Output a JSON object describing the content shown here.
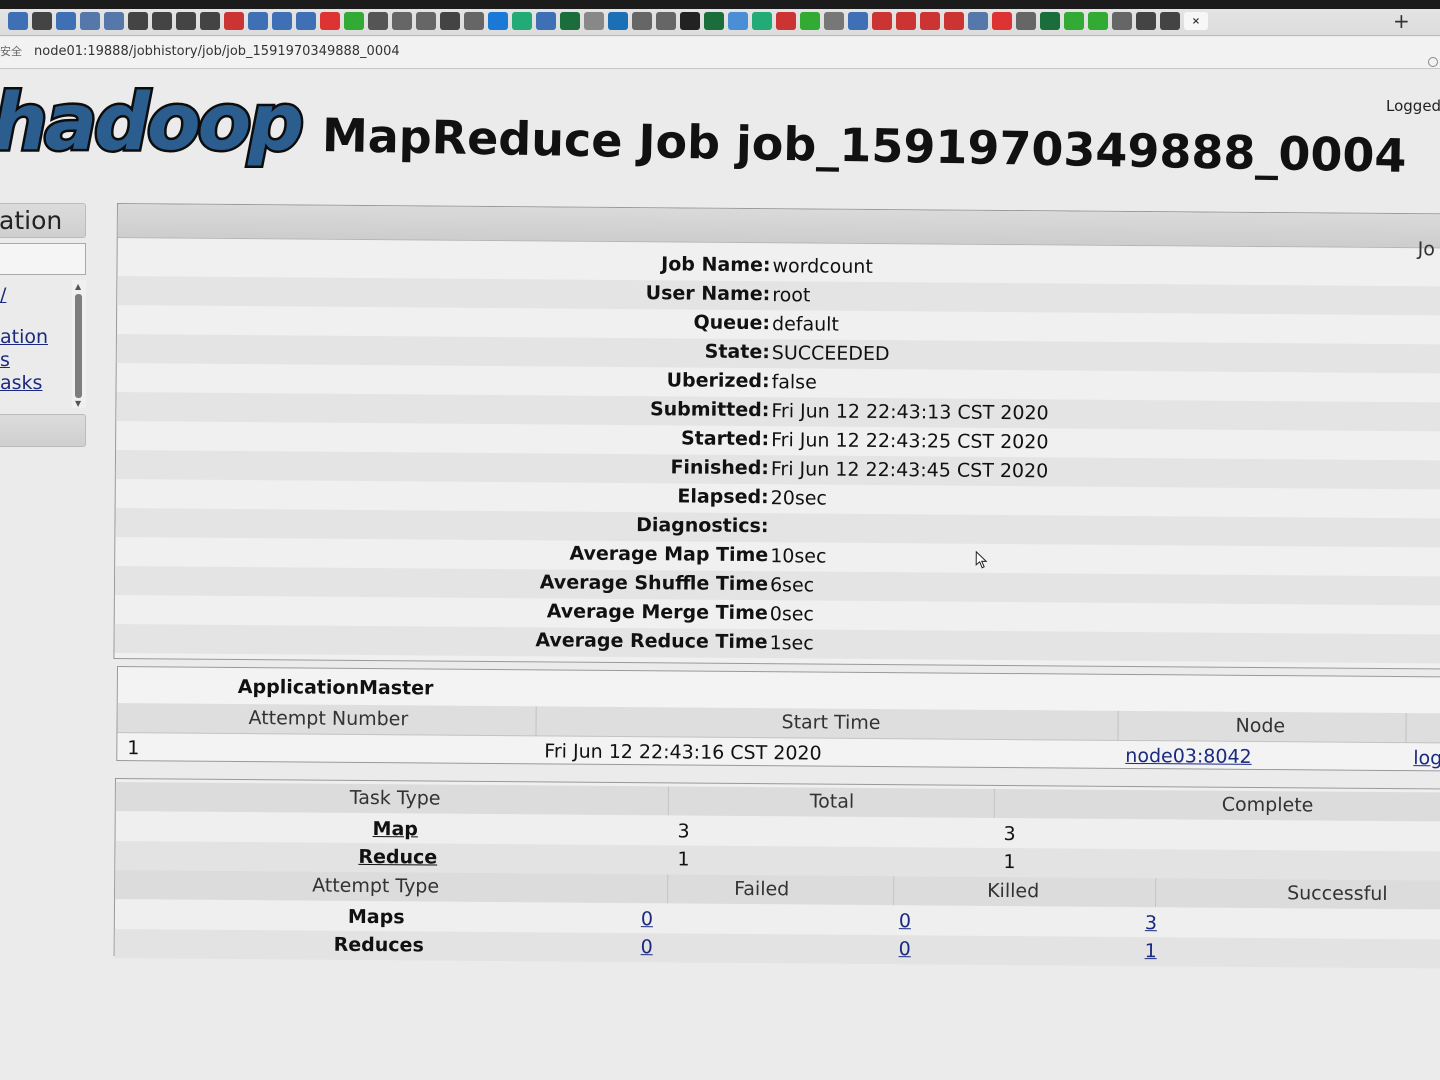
{
  "browser": {
    "secure_label": "安全",
    "url": "node01:19888/jobhistory/job/job_1591970349888_0004",
    "close_tab_glyph": "×",
    "new_tab_glyph": "+"
  },
  "header": {
    "logo_text": "hadoop",
    "title": "MapReduce Job job_1591970349888_0004",
    "logged_in": "Logged"
  },
  "sidebar": {
    "section_label": "ation",
    "links": [
      "/",
      "ation",
      "s",
      "asks"
    ]
  },
  "job_overview": {
    "panel_label": "Jo",
    "rows": [
      {
        "key": "Job Name:",
        "value": "wordcount"
      },
      {
        "key": "User Name:",
        "value": "root"
      },
      {
        "key": "Queue:",
        "value": "default"
      },
      {
        "key": "State:",
        "value": "SUCCEEDED"
      },
      {
        "key": "Uberized:",
        "value": "false"
      },
      {
        "key": "Submitted:",
        "value": "Fri Jun 12 22:43:13 CST 2020"
      },
      {
        "key": "Started:",
        "value": "Fri Jun 12 22:43:25 CST 2020"
      },
      {
        "key": "Finished:",
        "value": "Fri Jun 12 22:43:45 CST 2020"
      },
      {
        "key": "Elapsed:",
        "value": "20sec"
      },
      {
        "key": "Diagnostics:",
        "value": ""
      },
      {
        "key": "Average Map Time",
        "value": "10sec"
      },
      {
        "key": "Average Shuffle Time",
        "value": "6sec"
      },
      {
        "key": "Average Merge Time",
        "value": "0sec"
      },
      {
        "key": "Average Reduce Time",
        "value": "1sec"
      }
    ]
  },
  "application_master": {
    "title": "ApplicationMaster",
    "columns": [
      "Attempt Number",
      "Start Time",
      "Node"
    ],
    "row": {
      "attempt": "1",
      "start_time": "Fri Jun 12 22:43:16 CST 2020",
      "node": "node03:8042",
      "logs": "log"
    }
  },
  "task_summary": {
    "task_columns": [
      "Task Type",
      "Total",
      "Complete"
    ],
    "task_rows": [
      {
        "type": "Map",
        "total": "3",
        "complete": "3"
      },
      {
        "type": "Reduce",
        "total": "1",
        "complete": "1"
      }
    ],
    "attempt_columns": [
      "Attempt Type",
      "Failed",
      "Killed",
      "Successful"
    ],
    "attempt_rows": [
      {
        "type": "Maps",
        "failed": "0",
        "killed": "0",
        "successful": "3"
      },
      {
        "type": "Reduces",
        "failed": "0",
        "killed": "0",
        "successful": "1"
      }
    ]
  }
}
